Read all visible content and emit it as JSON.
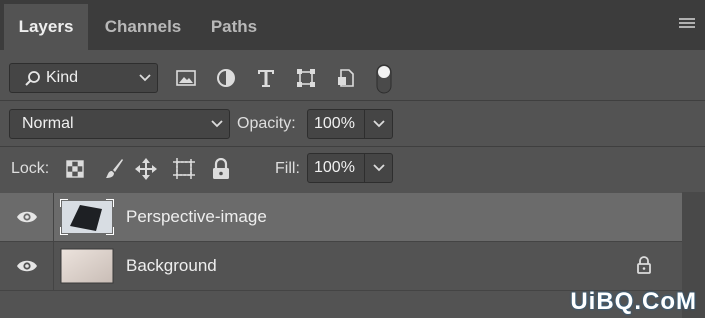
{
  "tabs": [
    {
      "label": "Layers",
      "active": true
    },
    {
      "label": "Channels",
      "active": false
    },
    {
      "label": "Paths",
      "active": false
    }
  ],
  "filter": {
    "kind_label": "Kind",
    "icons": [
      "image-filter-icon",
      "adjustment-filter-icon",
      "type-filter-icon",
      "shape-filter-icon",
      "smart-object-filter-icon",
      "filter-toggle-icon"
    ]
  },
  "blend": {
    "mode": "Normal",
    "opacity_label": "Opacity:",
    "opacity_value": "100%"
  },
  "lock": {
    "label": "Lock:",
    "icons": [
      "lock-transparent-pixels-icon",
      "lock-image-pixels-icon",
      "lock-position-icon",
      "lock-artboard-icon",
      "lock-all-icon"
    ],
    "fill_label": "Fill:",
    "fill_value": "100%"
  },
  "layers": [
    {
      "name": "Perspective-image",
      "selected": true,
      "visible": true,
      "locked": false
    },
    {
      "name": "Background",
      "selected": false,
      "visible": true,
      "locked": true
    }
  ],
  "watermark": "UiBQ.CoM",
  "colors": {
    "panel": "#535353",
    "tabbar": "#3c3c3c",
    "selected_row": "#6b6b6b"
  }
}
